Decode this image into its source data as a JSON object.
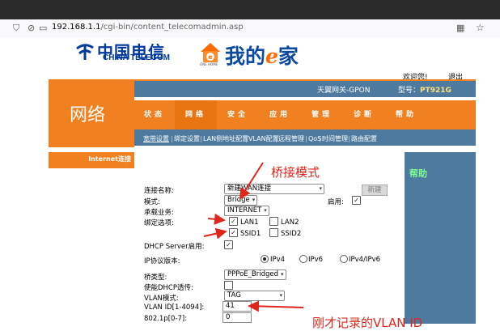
{
  "browser": {
    "url_host": "192.168.1.1",
    "url_path": "/cgi-bin/content_telecomadmin.asp",
    "icons": [
      "shield-icon",
      "no-tracking-icon",
      "page-info-icon",
      "qr-code-icon",
      "bookmark-star-icon"
    ]
  },
  "header": {
    "logo_cn": "中国电信",
    "logo_en": "CHINA TELECOM",
    "ehome_badge": "ONE HOME",
    "ehome_prefix": "我的",
    "ehome_e": "e",
    "ehome_suffix": "家",
    "welcome": "欢迎您!",
    "logout": "退出",
    "gateway_label": "天翼网关-GPON",
    "model_label": "型号：",
    "model_value": "PT921G"
  },
  "section_title": "网络",
  "nav": {
    "tabs": [
      "状态",
      "网络",
      "安全",
      "应用",
      "管理",
      "诊断",
      "帮助"
    ],
    "active": "网络"
  },
  "subnav": {
    "items": [
      "宽带设置",
      "绑定设置",
      "LAN侧地址配置",
      "VLAN配置",
      "远程管理",
      "QoS",
      "时间管理",
      "路由配置"
    ],
    "active": "宽带设置"
  },
  "sidebar": {
    "active_item": "Internet连接"
  },
  "help": {
    "label": "帮助"
  },
  "form": {
    "conn_name_label": "连接名称:",
    "conn_name_value": "新建WAN连接",
    "new_button": "新建",
    "mode_label": "模式:",
    "mode_value": "Bridge",
    "enable_label": "启用:",
    "enable_checked": true,
    "service_label": "承载业务:",
    "service_value": "INTERNET",
    "bind_label": "绑定选项:",
    "bind_options": [
      {
        "label": "LAN1",
        "checked": true
      },
      {
        "label": "LAN2",
        "checked": false
      },
      {
        "label": "SSID1",
        "checked": true
      },
      {
        "label": "SSID2",
        "checked": false
      }
    ],
    "dhcp_server_label": "DHCP Server启用:",
    "dhcp_server_checked": true,
    "ip_version_label": "IP协议版本:",
    "ip_versions": [
      "IPv4",
      "IPv6",
      "IPv4/IPv6"
    ],
    "ip_version_selected": "IPv4",
    "bridge_type_label": "桥类型:",
    "bridge_type_value": "PPPoE_Bridged",
    "dhcp_relay_label": "使能DHCP透传:",
    "dhcp_relay_checked": false,
    "vlan_mode_label": "VLAN模式:",
    "vlan_mode_value": "TAG",
    "vlan_id_label": "VLAN ID[1-4094]:",
    "vlan_id_value": "41",
    "p8021_label": "802.1p[0-7]:",
    "p8021_value": "0"
  },
  "annotations": {
    "bridge_mode": "桥接模式",
    "vlan_id_note": "刚才记录的VLAN ID"
  },
  "colors": {
    "orange": "#f08020",
    "steel_blue": "#4d7a9e",
    "telecom_blue": "#003a9a",
    "annotation_red": "#e0261c"
  }
}
